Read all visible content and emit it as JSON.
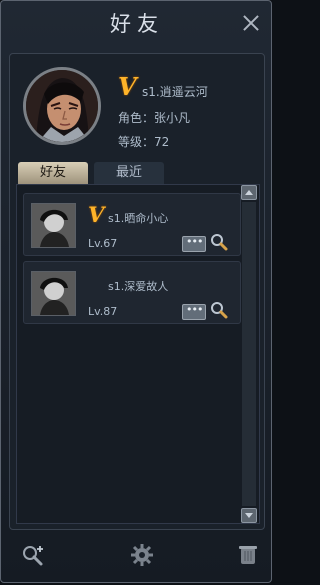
{
  "window": {
    "title": "好友"
  },
  "profile": {
    "badge": "V",
    "name": "s1.逍遥云河",
    "role_label": "角色：",
    "role_value": "张小凡",
    "level_label": "等级：",
    "level_value": "72"
  },
  "tabs": [
    {
      "label": "好友",
      "active": true
    },
    {
      "label": "最近",
      "active": false
    }
  ],
  "friends": [
    {
      "badge": "V",
      "name": "s1.晒命小心",
      "level": "Lv.67"
    },
    {
      "badge": "",
      "name": "s1.深爱故人",
      "level": "Lv.87"
    }
  ],
  "toolbar": {
    "icons": [
      "add-friend-icon",
      "settings-icon",
      "trash-icon"
    ]
  },
  "colors": {
    "accent": "#ffb429",
    "text": "#aebccb",
    "panel": "#1a212a"
  }
}
